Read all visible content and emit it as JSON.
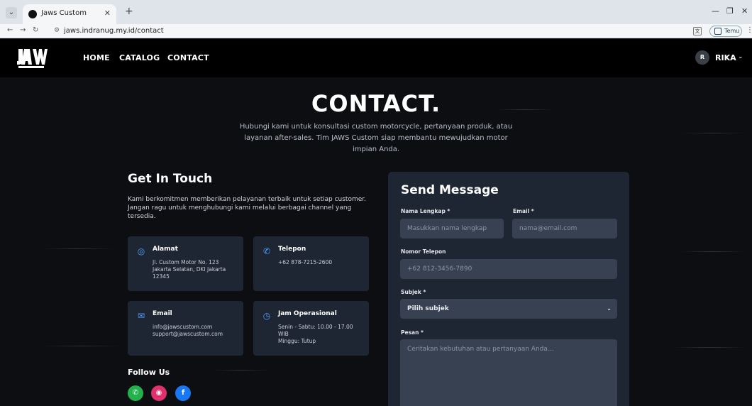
{
  "browser": {
    "tab_title": "Jaws Custom",
    "url": "jaws.indranug.my.id/contact",
    "extension_label": "Temu"
  },
  "nav": {
    "links": [
      "HOME",
      "CATALOG",
      "CONTACT"
    ],
    "user_initial": "R",
    "user_name": "RIKA"
  },
  "hero": {
    "title": "CONTACT.",
    "subtitle": "Hubungi kami untuk konsultasi custom motorcycle, pertanyaan produk, atau layanan after-sales. Tim JAWS Custom siap membantu mewujudkan motor impian Anda."
  },
  "touch": {
    "title": "Get In Touch",
    "description": "Kami berkomitmen memberikan pelayanan terbaik untuk setiap customer. Jangan ragu untuk menghubungi kami melalui berbagai channel yang tersedia.",
    "cards": [
      {
        "title": "Alamat",
        "lines": [
          "Jl. Custom Motor No. 123",
          "Jakarta Selatan, DKI Jakarta",
          "12345"
        ],
        "icon": "location-icon"
      },
      {
        "title": "Telepon",
        "lines": [
          "+62 878-7215-2600"
        ],
        "icon": "phone-icon"
      },
      {
        "title": "Email",
        "lines": [
          "info@jawscustom.com",
          "support@jawscustom.com"
        ],
        "icon": "mail-icon"
      },
      {
        "title": "Jam Operasional",
        "lines": [
          "Senin - Sabtu: 10.00 - 17.00",
          "WIB",
          "Minggu: Tutup"
        ],
        "icon": "clock-icon"
      }
    ],
    "follow_title": "Follow Us",
    "social": [
      {
        "icon": "whatsapp-icon",
        "color": "#22b14c"
      },
      {
        "icon": "instagram-icon",
        "color": "#e1306c"
      },
      {
        "icon": "facebook-icon",
        "color": "#1877f2"
      }
    ]
  },
  "form": {
    "title": "Send Message",
    "name_label": "Nama Lengkap *",
    "name_placeholder": "Masukkan nama lengkap",
    "email_label": "Email *",
    "email_placeholder": "nama@email.com",
    "phone_label": "Nomor Telepon",
    "phone_placeholder": "+62 812-3456-7890",
    "subject_label": "Subjek *",
    "subject_selected": "Pilih subjek",
    "message_label": "Pesan *",
    "message_placeholder": "Ceritakan kebutuhan atau pertanyaan Anda..."
  },
  "colors": {
    "accent": "#4ea1ff",
    "panel": "#1f2633",
    "input": "#374151"
  }
}
